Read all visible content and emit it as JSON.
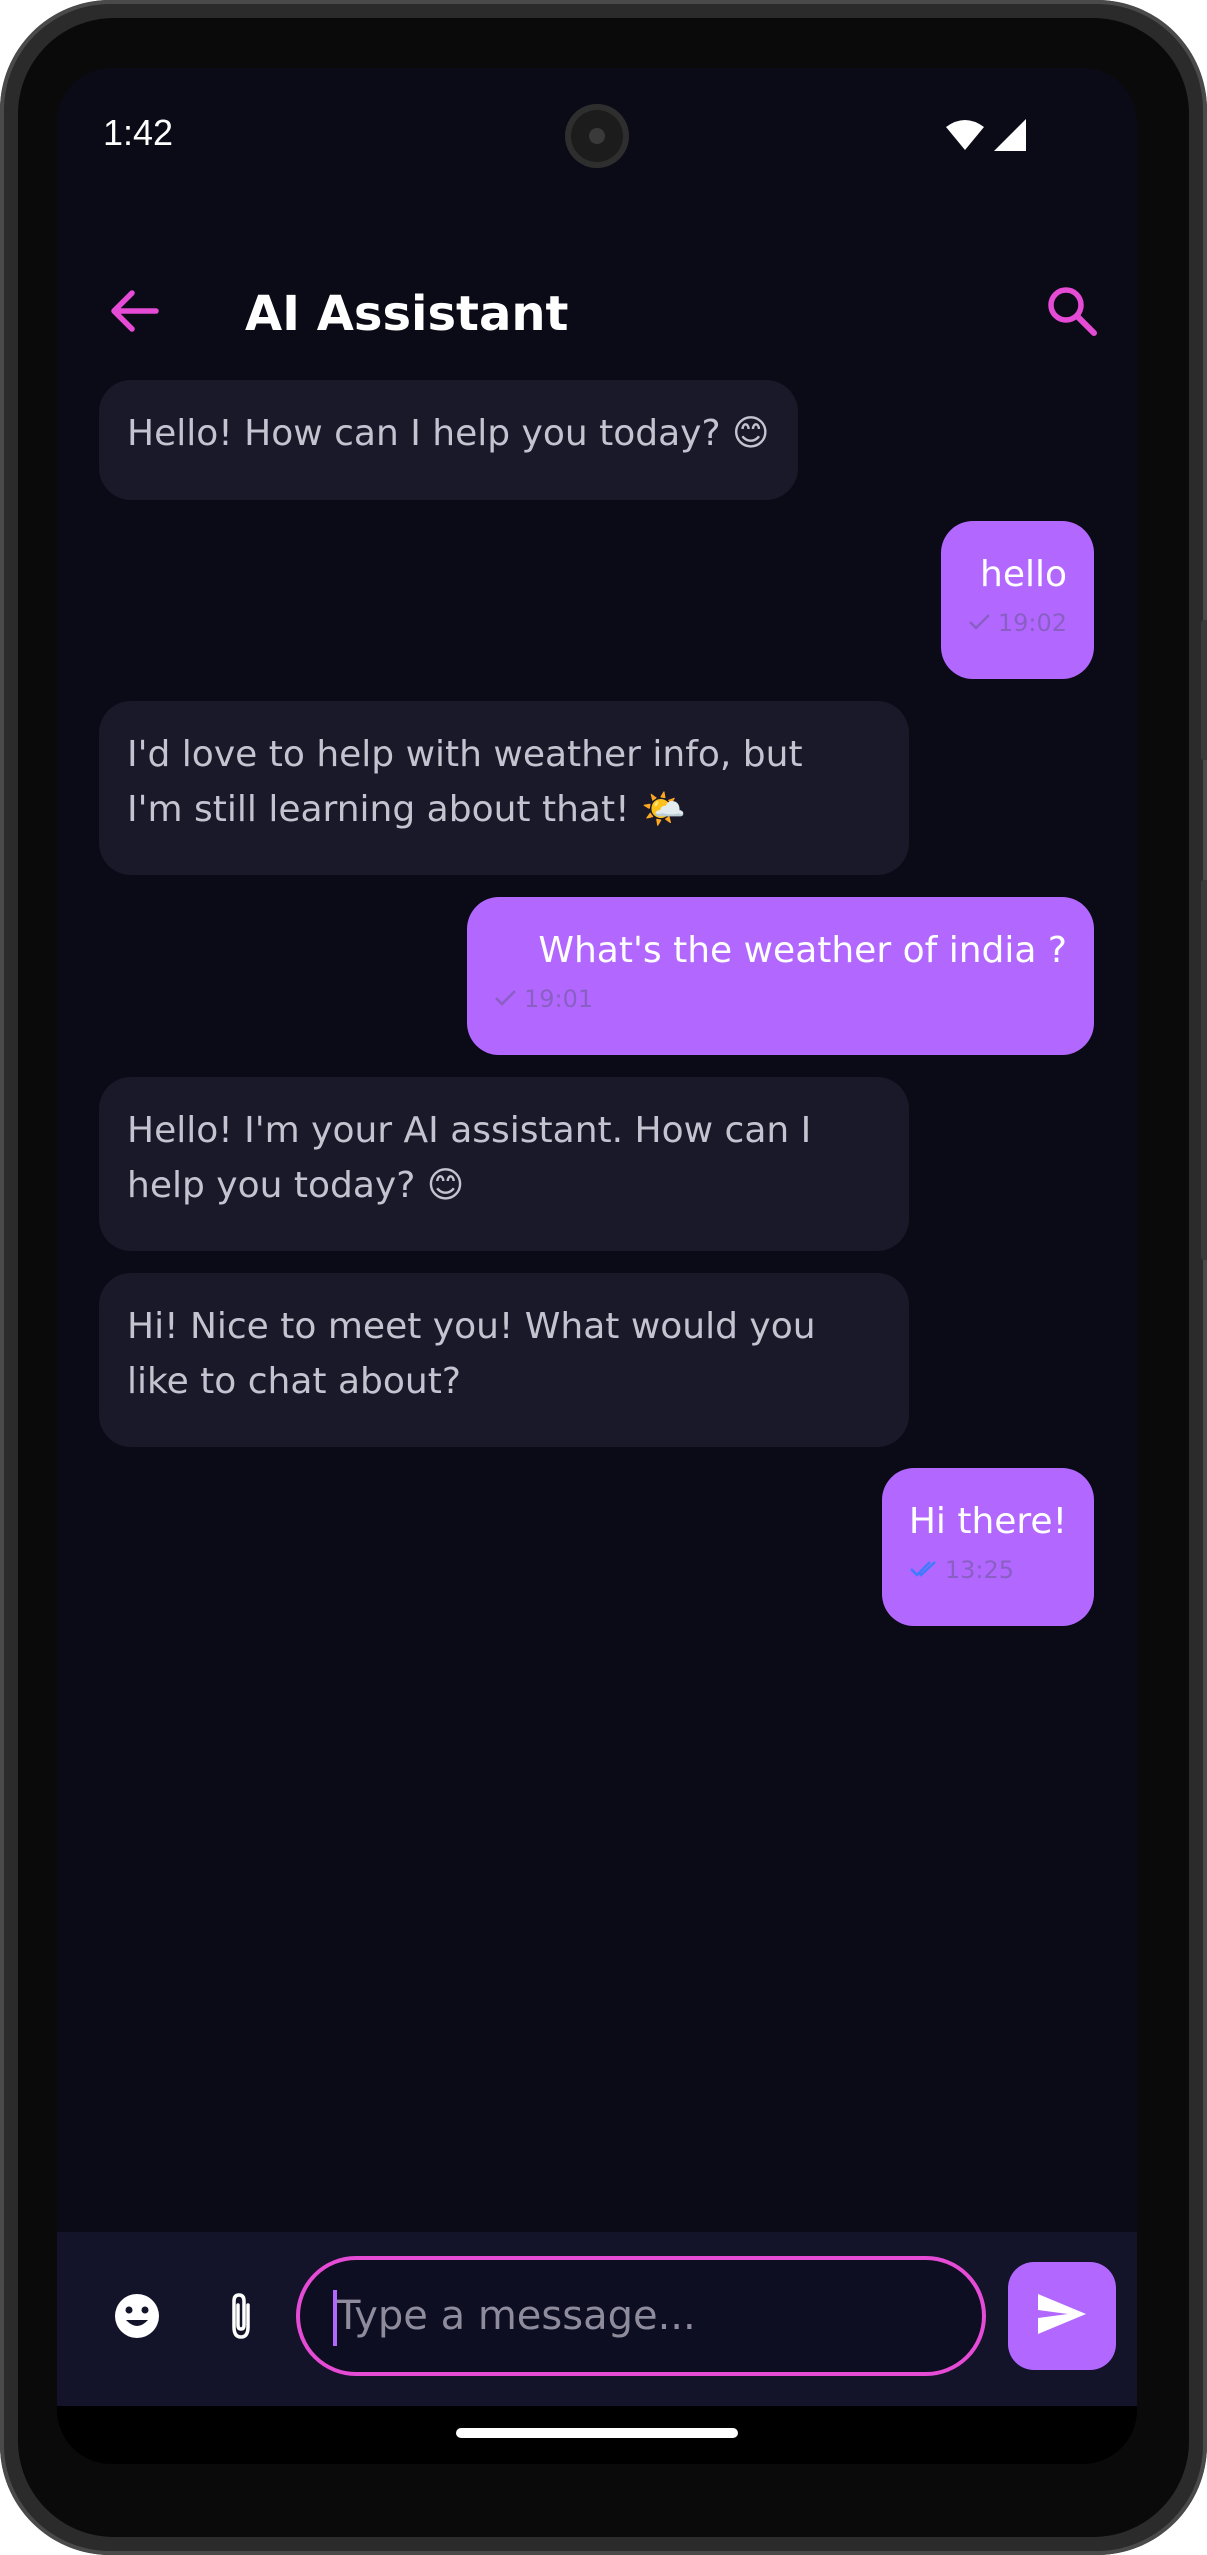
{
  "status_bar": {
    "time": "1:42"
  },
  "header": {
    "title": "AI Assistant",
    "back_icon": "arrow-left-icon",
    "search_icon": "search-icon"
  },
  "messages": [
    {
      "sender": "bot",
      "text": "Hello! How can I help you today? 😊"
    },
    {
      "sender": "user",
      "text": "hello",
      "time": "19:02",
      "status": "sent"
    },
    {
      "sender": "bot",
      "text": "I'd love to help with weather info, but\nI'm still learning about that! 🌤️"
    },
    {
      "sender": "user",
      "text": "What's the weather of india ?",
      "time": "19:01",
      "status": "sent"
    },
    {
      "sender": "bot",
      "text": "Hello! I'm your AI assistant. How can I\nhelp you today? 😊"
    },
    {
      "sender": "bot",
      "text": "Hi! Nice to meet you! What would you\nlike to chat about?"
    },
    {
      "sender": "user",
      "text": "Hi there!",
      "time": "13:25",
      "status": "read"
    }
  ],
  "composer": {
    "placeholder": "Type a message...",
    "value": ""
  },
  "colors": {
    "accent": "#e64bd5",
    "user_bubble": "#b268ff",
    "bot_bubble": "#191929",
    "background": "#0b0a17",
    "read_tick": "#3d7cff"
  }
}
